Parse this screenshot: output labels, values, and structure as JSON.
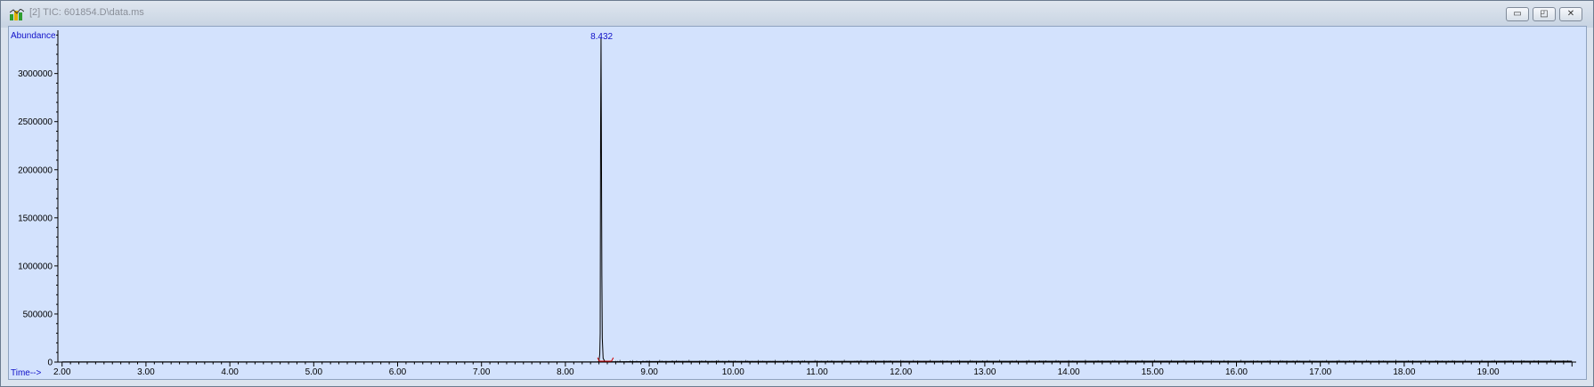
{
  "window": {
    "title": "[2] TIC: 601854.D\\data.ms",
    "icon": "chromatogram-app-icon",
    "buttons": [
      {
        "name": "minimize-button",
        "glyph": "▭"
      },
      {
        "name": "restore-button",
        "glyph": "◰"
      },
      {
        "name": "close-button",
        "glyph": "✕"
      }
    ]
  },
  "chart_data": {
    "type": "line",
    "ylabel": "Abundance",
    "xlabel": "Time-->",
    "xlim": [
      1.95,
      20.05
    ],
    "ylim": [
      0,
      3450000
    ],
    "x_ticks": [
      "2.00",
      "3.00",
      "4.00",
      "5.00",
      "6.00",
      "7.00",
      "8.00",
      "9.00",
      "10.00",
      "11.00",
      "12.00",
      "13.00",
      "14.00",
      "15.00",
      "16.00",
      "17.00",
      "18.00",
      "19.00"
    ],
    "y_ticks": [
      "0",
      "500000",
      "1000000",
      "1500000",
      "2000000",
      "2500000",
      "3000000"
    ],
    "peak_label": "8.432",
    "series": [
      {
        "color": "#000000",
        "points": [
          [
            2.0,
            2000
          ],
          [
            8.0,
            2000
          ],
          [
            8.38,
            2500
          ],
          [
            8.39,
            3000
          ],
          [
            8.4,
            10000
          ],
          [
            8.41,
            80000
          ],
          [
            8.415,
            300000
          ],
          [
            8.42,
            2450000
          ],
          [
            8.425,
            3380000
          ],
          [
            8.43,
            2200000
          ],
          [
            8.435,
            900000
          ],
          [
            8.44,
            250000
          ],
          [
            8.45,
            40000
          ],
          [
            8.47,
            8000
          ],
          [
            8.55,
            4000
          ],
          [
            9.0,
            6000
          ],
          [
            10.0,
            7000
          ],
          [
            12.0,
            8000
          ],
          [
            15.0,
            9000
          ],
          [
            18.0,
            8000
          ],
          [
            20.0,
            9000
          ]
        ]
      }
    ],
    "colors": {
      "plot_bg": "#d3e2fd",
      "axis": "#000000",
      "label_text": "#1010c8",
      "baseline_marker": "#d00000"
    }
  }
}
